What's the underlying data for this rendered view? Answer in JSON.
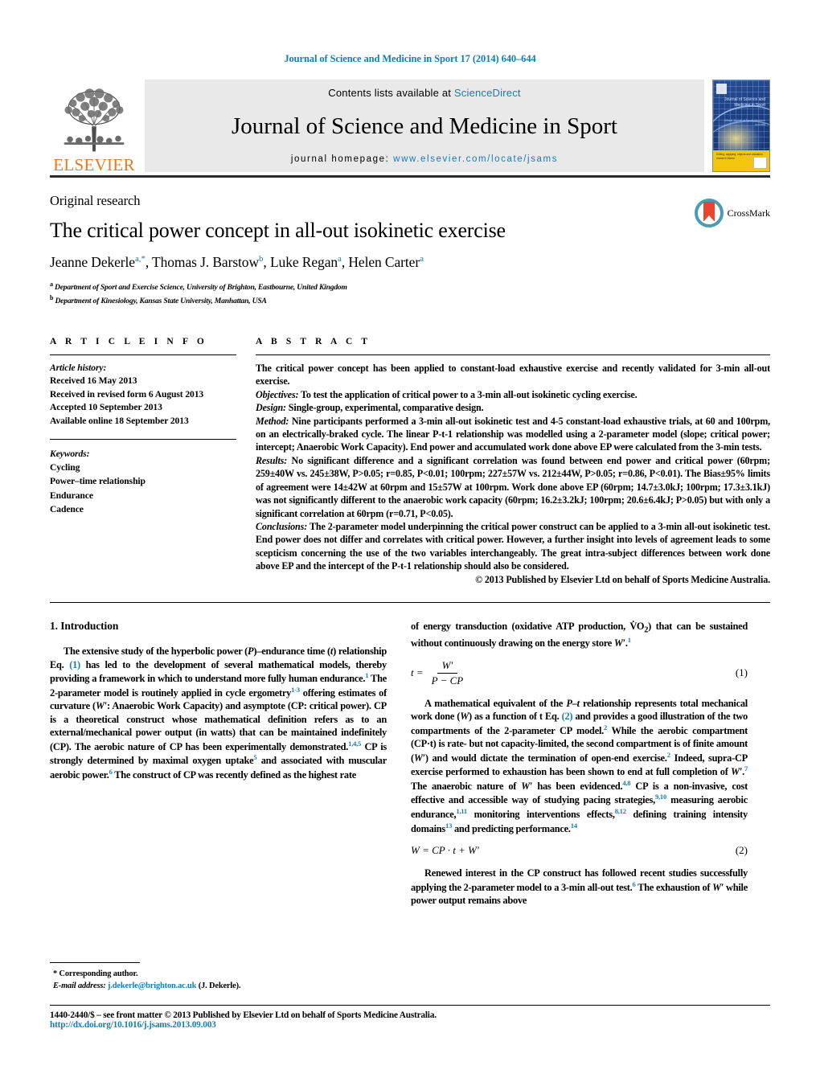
{
  "running_head": "Journal of Science and Medicine in Sport 17 (2014) 640–644",
  "masthead": {
    "publisher": "ELSEVIER",
    "contents_text": "Contents lists available at",
    "contents_link": "ScienceDirect",
    "journal_title": "Journal of Science and Medicine in Sport",
    "homepage_label": "journal homepage:",
    "homepage_url": "www.elsevier.com/locate/jsams",
    "cover": {
      "title_lines": "Journal of Science and Medicine in Sport",
      "sub_lines": "Official Journal of Sports Medicine Australia",
      "band_lines": "Editing, applying, objects and validation research theme"
    }
  },
  "article": {
    "kicker": "Original research",
    "title": "The critical power concept in all-out isokinetic exercise",
    "authors": [
      {
        "name": "Jeanne Dekerle",
        "marks": "a,*"
      },
      {
        "name": "Thomas J. Barstow",
        "marks": "b"
      },
      {
        "name": "Luke Regan",
        "marks": "a"
      },
      {
        "name": "Helen Carter",
        "marks": "a"
      }
    ],
    "affiliations": [
      {
        "mark": "a",
        "text": "Department of Sport and Exercise Science, University of Brighton, Eastbourne, United Kingdom"
      },
      {
        "mark": "b",
        "text": "Department of Kinesiology, Kansas State University, Manhattan, USA"
      }
    ],
    "crossmark_label": "CrossMark"
  },
  "info": {
    "heading": "A R T I C L E    I N F O",
    "history_label": "Article history:",
    "history": [
      "Received 16 May 2013",
      "Received in revised form 6 August 2013",
      "Accepted 10 September 2013",
      "Available online 18 September 2013"
    ],
    "keywords_label": "Keywords:",
    "keywords": [
      "Cycling",
      "Power–time relationship",
      "Endurance",
      "Cadence"
    ]
  },
  "abstract": {
    "heading": "A B S T R A C T",
    "intro": "The critical power concept has been applied to constant-load exhaustive exercise and recently validated for 3-min all-out exercise.",
    "sections": [
      {
        "label": "Objectives:",
        "text": " To test the application of critical power to a 3-min all-out isokinetic cycling exercise."
      },
      {
        "label": "Design:",
        "text": " Single-group, experimental, comparative design."
      },
      {
        "label": "Method:",
        "text": " Nine participants performed a 3-min all-out isokinetic test and 4-5 constant-load exhaustive trials, at 60 and 100rpm, on an electrically-braked cycle. The linear P-t-1 relationship was modelled using a 2-parameter model (slope; critical power; intercept; Anaerobic Work Capacity). End power and accumulated work done above EP were calculated from the 3-min tests."
      },
      {
        "label": "Results:",
        "text": " No significant difference and a significant correlation was found between end power and critical power (60rpm; 259±40W vs. 245±38W, P>0.05; r=0.85, P<0.01; 100rpm; 227±57W vs. 212±44W, P>0.05; r=0.86, P<0.01). The Bias±95% limits of agreement were 14±42W at 60rpm and 15±57W at 100rpm. Work done above EP (60rpm; 14.7±3.0kJ; 100rpm; 17.3±3.1kJ) was not significantly different to the anaerobic work capacity (60rpm; 16.2±3.2kJ; 100rpm; 20.6±6.4kJ; P>0.05) but with only a significant correlation at 60rpm (r=0.71, P<0.05)."
      },
      {
        "label": "Conclusions:",
        "text": " The 2-parameter model underpinning the critical power construct can be applied to a 3-min all-out isokinetic test. End power does not differ and correlates with critical power. However, a further insight into levels of agreement leads to some scepticism concerning the use of the two variables interchangeably. The great intra-subject differences between work done above EP and the intercept of the P-t-1 relationship should also be considered."
      }
    ],
    "copyright": "© 2013 Published by Elsevier Ltd on behalf of Sports Medicine Australia."
  },
  "introduction": {
    "heading": "1.  Introduction",
    "left_p1_a": "The extensive study of the hyperbolic power (",
    "left_p1_b": "P",
    "left_p1_c": ")–endurance time (",
    "left_p1_d": "t",
    "left_p1_e": ") relationship Eq. ",
    "left_cite_eq1": "(1)",
    "left_p1_f": " has led to the development of several mathematical models, thereby providing a framework in which to understand more fully human endurance.",
    "left_cite_1": "1",
    "left_p1_g": " The 2-parameter model is routinely applied in cycle ergometry",
    "left_cite_13": "1-3",
    "left_p1_h": " offering estimates of curvature (",
    "left_p1_i": "W′",
    "left_p1_j": ": Anaerobic Work Capacity) and asymptote (CP: critical power). CP is a theoretical construct whose mathematical definition refers as to an external/mechanical power output (in watts) that can be maintained indefinitely (CP). The aerobic nature of CP has been experimentally demonstrated.",
    "left_cite_145": "1,4,5",
    "left_p1_k": " CP is strongly determined by maximal oxygen uptake",
    "left_cite_5": "5",
    "left_p1_l": " and associated with muscular aerobic power.",
    "left_cite_6": "6",
    "left_p1_m": " The construct of CP was recently defined as the highest rate",
    "right_p0_a": "of energy transduction (oxidative ATP production, V̇O",
    "right_p0_sub": "2",
    "right_p0_b": ") that can be sustained without continuously drawing on the energy store ",
    "right_p0_c": "W′",
    "right_p0_d": ".",
    "right_cite_1": "1",
    "eq1": {
      "lhs": "t =",
      "num": "W′",
      "den": "P − CP",
      "number": "(1)"
    },
    "right_p1_a": "A mathematical equivalent of the ",
    "right_p1_b": "P–t",
    "right_p1_c": " relationship represents total mechanical work done (",
    "right_p1_d": "W",
    "right_p1_e": ") as a function of t Eq. ",
    "right_cite_eq2": "(2)",
    "right_p1_f": " and provides a good illustration of the two compartments of the 2-parameter CP model.",
    "right_cite_2a": "2",
    "right_p1_g": " While the aerobic compartment (CP·t) is rate- but not capacity-limited, the second compartment is of finite amount (",
    "right_p1_h": "W′",
    "right_p1_i": ") and would dictate the termination of open-end exercise.",
    "right_cite_2b": "2",
    "right_p1_j": " Indeed, supra-CP exercise performed to exhaustion has been shown to end at full completion of ",
    "right_p1_k": "W′",
    "right_p1_l": ".",
    "right_cite_7": "7",
    "right_p1_m": " The anaerobic nature of ",
    "right_p1_n": "W′",
    "right_p1_o": " has been evidenced.",
    "right_cite_48": "4,8",
    "right_p1_p": " CP is a non-invasive, cost effective and accessible way of studying pacing strategies,",
    "right_cite_910": "9,10",
    "right_p1_q": " measuring aerobic endurance,",
    "right_cite_111": "1,11",
    "right_p1_r": " monitoring interventions effects,",
    "right_cite_812": "8,12",
    "right_p1_s": " defining training intensity domains",
    "right_cite_13": "13",
    "right_p1_t": " and predicting performance.",
    "right_cite_14": "14",
    "eq2": {
      "expr": "W = CP · t + W′",
      "number": "(2)"
    },
    "right_p2_a": "Renewed interest in the CP construct has followed recent studies successfully applying the 2-parameter model to a 3-min all-out test.",
    "right_cite_6": "6",
    "right_p2_b": " The exhaustion of ",
    "right_p2_c": "W′",
    "right_p2_d": " while power output remains above"
  },
  "footnotes": {
    "corresponding": "*  Corresponding author.",
    "email_label": "E-mail address:",
    "email": "j.dekerle@brighton.ac.uk",
    "email_owner": "(J. Dekerle)."
  },
  "page_footer": {
    "line1": "1440-2440/$ – see front matter © 2013 Published by Elsevier Ltd on behalf of Sports Medicine Australia.",
    "doi": "http://dx.doi.org/10.1016/j.jsams.2013.09.003"
  },
  "colors": {
    "link": "#1a7bb0",
    "elsevier_orange": "#E87722",
    "crossmark_teal": "#4a9cb5",
    "crossmark_red": "#e8452c"
  }
}
